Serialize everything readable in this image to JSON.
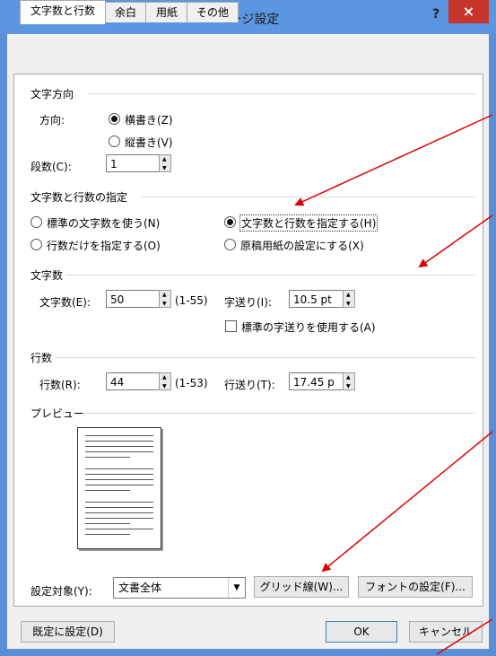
{
  "window": {
    "title": "ページ設定",
    "help_label": "?",
    "close_label": "×"
  },
  "tabs": [
    "文字数と行数",
    "余白",
    "用紙",
    "その他"
  ],
  "direction": {
    "section": "文字方向",
    "label": "方向:",
    "horizontal": "横書き(Z)",
    "vertical": "縦書き(V)",
    "columns_label": "段数(C):",
    "columns_value": "1",
    "selected": "horizontal"
  },
  "grid_spec": {
    "section": "文字数と行数の指定",
    "opt_standard": "標準の文字数を使う(N)",
    "opt_chars_lines": "文字数と行数を指定する(H)",
    "opt_lines_only": "行数だけを指定する(O)",
    "opt_manuscript": "原稿用紙の設定にする(X)",
    "selected": "opt_chars_lines"
  },
  "chars": {
    "section": "文字数",
    "count_label": "文字数(E):",
    "count_value": "50",
    "range": "(1-55)",
    "pitch_label": "字送り(I):",
    "pitch_value": "10.5 pt",
    "use_standard_label": "標準の字送りを使用する(A)",
    "use_standard_checked": false
  },
  "lines": {
    "section": "行数",
    "count_label": "行数(R):",
    "count_value": "44",
    "range": "(1-53)",
    "pitch_label": "行送り(T):",
    "pitch_value": "17.45 p"
  },
  "preview": {
    "section": "プレビュー"
  },
  "apply": {
    "label": "設定対象(Y):",
    "value": "文書全体",
    "dropdown_icon": "chevron-down-icon"
  },
  "buttons": {
    "grid": "グリッド線(W)...",
    "font": "フォントの設定(F)...",
    "default": "既定に設定(D)",
    "ok": "OK",
    "cancel": "キャンセル"
  },
  "colors": {
    "titlebar": "#5b97e0",
    "close": "#c7352a",
    "annotation_arrow": "#e00000"
  }
}
